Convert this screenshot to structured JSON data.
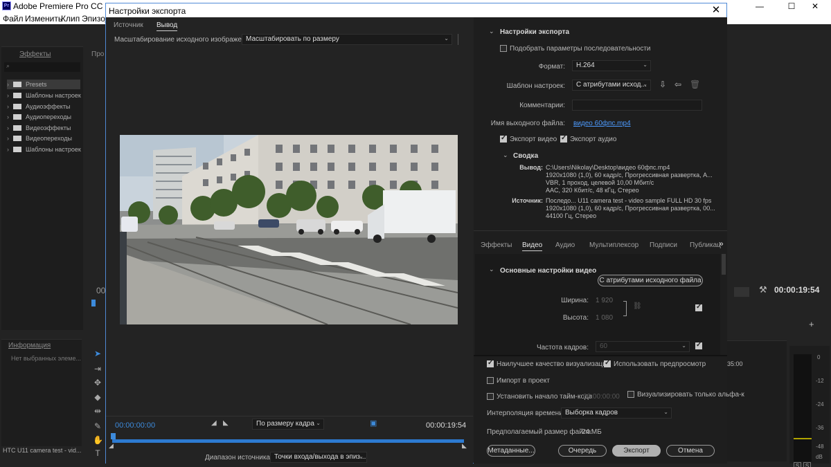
{
  "app": {
    "title": "Adobe Premiere Pro CC 2018 - C",
    "logo": "Pr",
    "menu": [
      "Файл",
      "Изменить",
      "Клип",
      "Эпизод"
    ],
    "window_controls": [
      "—",
      "☐",
      "✕"
    ]
  },
  "background": {
    "effects_tab": "Эффекты",
    "effects_tree": [
      "Presets",
      "Шаблоны настроек",
      "Аудиоэффекты",
      "Аудиопереходы",
      "Видеоэффекты",
      "Видеопереходы",
      "Шаблоны настроек"
    ],
    "program_tab": "Про",
    "info_tab": "Информация",
    "info_text": "Нет выбранных элеме...",
    "project_clip": "HTC U11 camera test - vid...",
    "left_timecode": "00",
    "right_timecode": "00:00:19:54",
    "timeline_timecode": "35:00",
    "meter_scale": [
      "0",
      "-12",
      "-24",
      "-36",
      "-48",
      "dB"
    ],
    "meter_buttons": [
      "S",
      "S"
    ]
  },
  "dialog": {
    "title": "Настройки экспорта",
    "close": "✕",
    "left": {
      "tabs": [
        "Источник",
        "Вывод"
      ],
      "active_tab": 1,
      "scaling_label": "Масштабирование исходного изображения:",
      "scaling_value": "Масштабировать по размеру",
      "timecode_start": "00:00:00:00",
      "timecode_end": "00:00:19:54",
      "fit_value": "По размеру кадра",
      "range_label": "Диапазон источника:",
      "range_value": "Точки входа/выхода в эпиз..."
    },
    "right": {
      "section_title": "Настройки экспорта",
      "match_seq_label": "Подобрать параметры последовательности",
      "match_seq_checked": false,
      "format_label": "Формат:",
      "format_value": "H.264",
      "preset_label": "Шаблон настроек:",
      "preset_value": "С атрибутами исход...",
      "comments_label": "Комментарии:",
      "comments_value": "",
      "output_name_label": "Имя выходного файла:",
      "output_name_value": "видео 60фпс.mp4",
      "export_video_label": "Экспорт видео",
      "export_video_checked": true,
      "export_audio_label": "Экспорт аудио",
      "export_audio_checked": true,
      "summary_title": "Сводка",
      "summary_output_label": "Вывод:",
      "summary_output_lines": [
        "C:\\Users\\Nikolay\\Desktop\\видео 60фпс.mp4",
        "1920x1080 (1,0), 60 кадр/с, Прогрессивная развертка, A...",
        "VBR, 1 проход, целевой 10,00 Мбит/с",
        "AAC, 320 Кбит/с, 48 кГц, Стерео"
      ],
      "summary_source_label": "Источник:",
      "summary_source_lines": [
        "Последо... U11 camera test - video sample FULL HD 30 fps",
        "1920x1080 (1,0), 60 кадр/с, Прогрессивная развертка, 00...",
        "44100 Гц, Стерео"
      ],
      "tabs": [
        "Эффекты",
        "Видео",
        "Аудио",
        "Мультиплексор",
        "Подписи",
        "Публикац"
      ],
      "active_tab": 1,
      "more_tabs": "»",
      "basic_video_title": "Основные настройки видео",
      "match_source_button": "С атрибутами исходного файла",
      "width_label": "Ширина:",
      "width_value": "1 920",
      "height_label": "Высота:",
      "height_value": "1 080",
      "framerate_label": "Частота кадров:",
      "framerate_value": "60"
    },
    "bottom": {
      "max_quality_label": "Наилучшее качество визуализации",
      "max_quality_checked": true,
      "use_previews_label": "Использовать предпросмотр",
      "use_previews_checked": true,
      "import_label": "Импорт в проект",
      "import_checked": false,
      "set_timecode_label": "Установить начало тайм-кода",
      "set_timecode_checked": false,
      "set_timecode_value": "00:00:00:00",
      "alpha_label": "Визуализировать только альфа-к",
      "alpha_checked": false,
      "interp_label": "Интерполяция времени:",
      "interp_value": "Выборка кадров",
      "filesize_label": "Предполагаемый размер файла:",
      "filesize_value": "24 МБ",
      "metadata_button": "Метаданные...",
      "queue_button": "Очередь",
      "export_button": "Экспорт",
      "cancel_button": "Отмена"
    }
  }
}
